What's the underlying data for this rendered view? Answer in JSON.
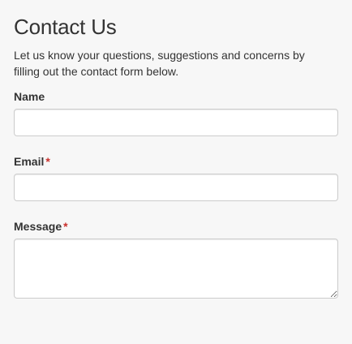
{
  "contact": {
    "title": "Contact Us",
    "intro": "Let us know your questions, suggestions and concerns by filling out the contact form below.",
    "fields": {
      "name": {
        "label": "Name",
        "value": "",
        "placeholder": ""
      },
      "email": {
        "label": "Email",
        "required_marker": "*",
        "value": "",
        "placeholder": ""
      },
      "message": {
        "label": "Message",
        "required_marker": "*",
        "value": "",
        "placeholder": ""
      }
    }
  },
  "colors": {
    "background": "#f7f7f7",
    "text": "#333333",
    "required": "#c9302c",
    "input_border": "#cccccc",
    "input_background": "#ffffff"
  }
}
